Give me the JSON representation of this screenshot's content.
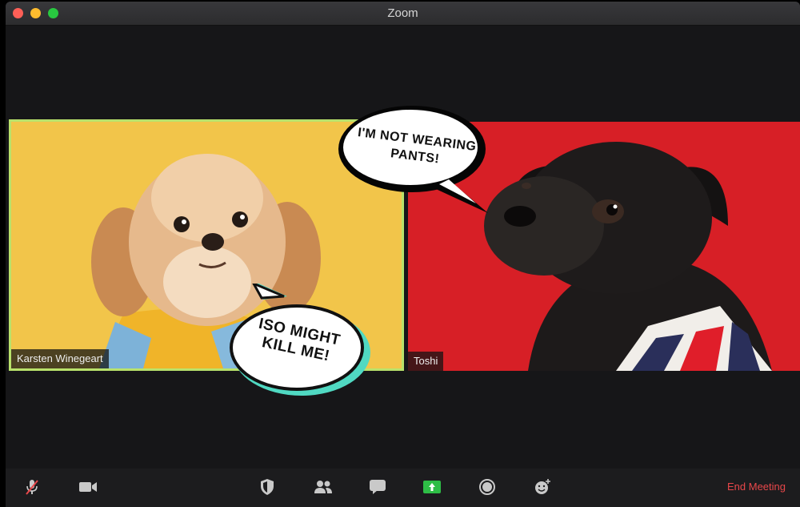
{
  "window": {
    "title": "Zoom"
  },
  "participants": [
    {
      "name": "Karsten Winegeart",
      "speaking": true,
      "speech_bubble": [
        "ISO MIGHT",
        "KILL ME!"
      ]
    },
    {
      "name": "Toshi",
      "speaking": false,
      "speech_bubble": [
        "I'M NOT WEARING",
        "PANTS!"
      ]
    }
  ],
  "toolbar": {
    "buttons": [
      "microphone-muted-icon",
      "video-camera-icon",
      "security-shield-icon",
      "participants-icon",
      "chat-icon",
      "share-screen-icon",
      "record-icon",
      "reactions-icon"
    ],
    "end_meeting_label": "End Meeting"
  },
  "colors": {
    "active_speaker_border": "#b9e26b",
    "share_screen": "#2ebd46",
    "end_meeting": "#e8474a",
    "left_background": "#f2c54a",
    "right_background": "#d71f26"
  }
}
